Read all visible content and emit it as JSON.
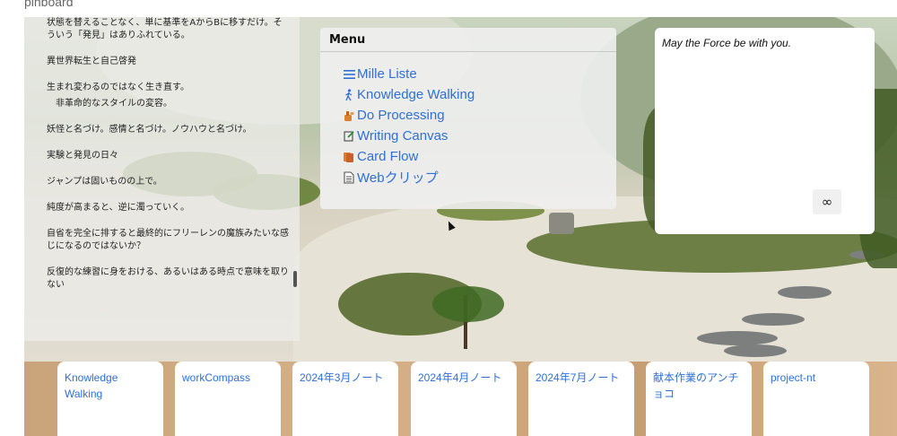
{
  "app": {
    "title": "pinboard"
  },
  "notes": {
    "lines": [
      "状態を替えることなく、単に基準をAからBに移すだけ。そういう「発見」はありふれている。",
      "異世界転生と自己啓発",
      "生まれ変わるのではなく生き直す。",
      "非革命的なスタイルの変容。",
      "妖怪と名づけ。感情と名づけ。ノウハウと名づけ。",
      "実験と発見の日々",
      "ジャンプは固いものの上で。",
      "純度が高まると、逆に濁っていく。",
      "自省を完全に排すると最終的にフリーレンの魔族みたいな感じになるのではないか？",
      "反復的な練習に身をおける、あるいはある時点で意味を取りない"
    ]
  },
  "menu": {
    "title": "Menu",
    "items": [
      {
        "label": "Mille Liste",
        "icon": "list-icon"
      },
      {
        "label": "Knowledge Walking",
        "icon": "walking-person-icon"
      },
      {
        "label": "Do Processing",
        "icon": "tools-icon"
      },
      {
        "label": "Writing Canvas",
        "icon": "edit-icon"
      },
      {
        "label": "Card Flow",
        "icon": "cards-icon"
      },
      {
        "label": "Webクリップ",
        "icon": "document-icon"
      }
    ]
  },
  "quote": {
    "text": "May the Force be with you.",
    "button": "∞"
  },
  "cards": [
    "Knowledge Walking",
    "workCompass",
    "2024年3月ノート",
    "2024年4月ノート",
    "2024年7月ノート",
    "献本作業のアンチョコ",
    "project-nt"
  ]
}
